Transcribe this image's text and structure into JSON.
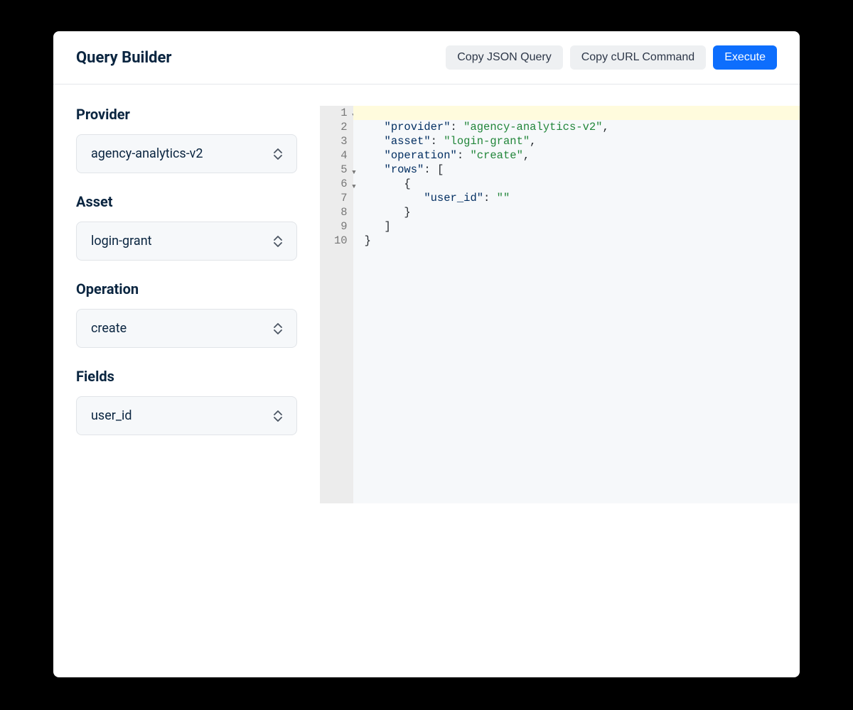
{
  "header": {
    "title": "Query Builder",
    "buttons": {
      "copy_json": "Copy JSON Query",
      "copy_curl": "Copy cURL Command",
      "execute": "Execute"
    }
  },
  "form": {
    "provider": {
      "label": "Provider",
      "value": "agency-analytics-v2"
    },
    "asset": {
      "label": "Asset",
      "value": "login-grant"
    },
    "operation": {
      "label": "Operation",
      "value": "create"
    },
    "fields": {
      "label": "Fields",
      "value": "user_id"
    }
  },
  "editor": {
    "lines": [
      {
        "num": "1",
        "fold": true
      },
      {
        "num": "2"
      },
      {
        "num": "3"
      },
      {
        "num": "4"
      },
      {
        "num": "5",
        "fold": true
      },
      {
        "num": "6",
        "fold": true
      },
      {
        "num": "7"
      },
      {
        "num": "8"
      },
      {
        "num": "9"
      },
      {
        "num": "10"
      }
    ],
    "tokens": {
      "l1_brace": "{",
      "l2_key": "\"provider\"",
      "l2_colon": ": ",
      "l2_val": "\"agency-analytics-v2\"",
      "l2_comma": ",",
      "l3_key": "\"asset\"",
      "l3_colon": ": ",
      "l3_val": "\"login-grant\"",
      "l3_comma": ",",
      "l4_key": "\"operation\"",
      "l4_colon": ": ",
      "l4_val": "\"create\"",
      "l4_comma": ",",
      "l5_key": "\"rows\"",
      "l5_colon": ": ",
      "l5_bracket": "[",
      "l6_brace": "{",
      "l7_key": "\"user_id\"",
      "l7_colon": ": ",
      "l7_val": "\"\"",
      "l8_brace": "}",
      "l9_bracket": "]",
      "l10_brace": "}"
    }
  }
}
